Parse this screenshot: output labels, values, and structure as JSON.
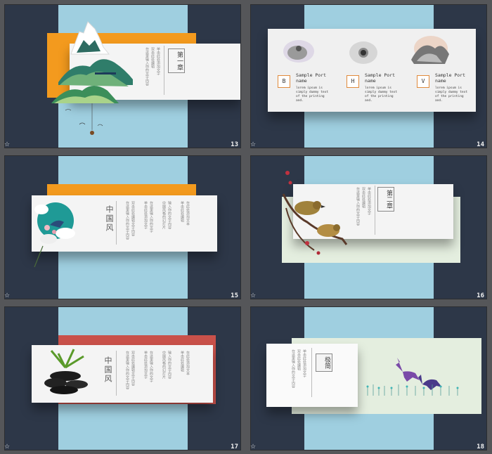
{
  "slides": [
    {
      "number": "13",
      "star": "☆",
      "chapter": "第一章",
      "col_texts": [
        "在这里输入你的文字内容",
        "双击此处编辑",
        "单击此处添加文字"
      ]
    },
    {
      "number": "14",
      "star": "☆",
      "items": [
        {
          "letter": "B",
          "title": "Sample Port name",
          "body": "lorem ipsum is simply dummy text of the printing and."
        },
        {
          "letter": "H",
          "title": "Sample Port name",
          "body": "lorem ipsum is simply dummy text of the printing and."
        },
        {
          "letter": "V",
          "title": "Sample Port name",
          "body": "lorem ipsum is simply dummy text of the printing and."
        }
      ]
    },
    {
      "number": "15",
      "star": "☆",
      "title": "中国风",
      "col_texts": [
        "在这里输入你的文字内容",
        "双击此处编辑文字内容",
        "单击此处添加文字",
        "在这里输入你的文字",
        "中国风格的幻灯片",
        "输入你的文字内容",
        "单击此处编辑",
        "在此处添加文本"
      ]
    },
    {
      "number": "16",
      "star": "☆",
      "chapter": "第二章",
      "col_texts": [
        "在这里输入你的文字内容",
        "双击此处编辑",
        "单击此处添加文字"
      ]
    },
    {
      "number": "17",
      "star": "☆",
      "title": "中国风",
      "col_texts": [
        "在这里输入你的文字内容",
        "双击此处编辑文字内容",
        "单击此处添加文字",
        "在这里输入你的文字",
        "中国风格的幻灯片",
        "输入你的文字内容",
        "单击此处编辑",
        "在此处添加文本"
      ]
    },
    {
      "number": "18",
      "star": "☆",
      "chapter": "极简",
      "col_texts": [
        "在这里输入你的文字内容",
        "双击此处编辑",
        "单击此处添加文字"
      ]
    }
  ]
}
